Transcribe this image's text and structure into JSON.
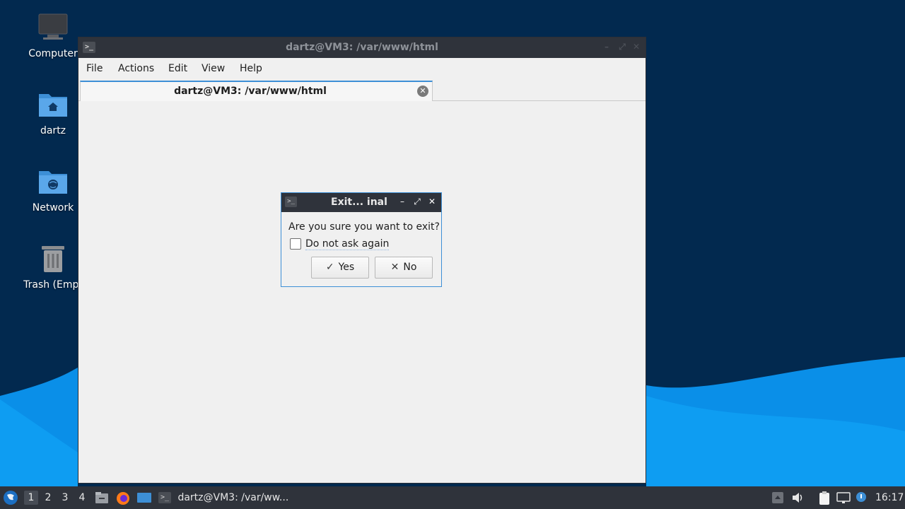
{
  "desktop": {
    "icons": [
      {
        "label": "Computer",
        "icon": "computer-icon"
      },
      {
        "label": "dartz",
        "icon": "home-folder-icon"
      },
      {
        "label": "Network",
        "icon": "network-folder-icon"
      },
      {
        "label": "Trash (Empt",
        "icon": "trash-icon"
      }
    ]
  },
  "terminal": {
    "title": "dartz@VM3: /var/www/html",
    "menu": [
      "File",
      "Actions",
      "Edit",
      "View",
      "Help"
    ],
    "tab_title": "dartz@VM3: /var/www/html"
  },
  "dialog": {
    "title": "Exit... inal",
    "message": "Are you sure you want to exit?",
    "checkbox_label": "Do not ask again",
    "checkbox_checked": false,
    "yes_label": "Yes",
    "no_label": "No"
  },
  "taskbar": {
    "workspaces": [
      "1",
      "2",
      "3",
      "4"
    ],
    "active_workspace": "1",
    "task_label": "dartz@VM3: /var/ww...",
    "clock": "16:17"
  },
  "colors": {
    "accent": "#3d8fd6",
    "titlebar": "#2f333b",
    "desktop": "#02294f",
    "wave": "#0a8fe8"
  }
}
